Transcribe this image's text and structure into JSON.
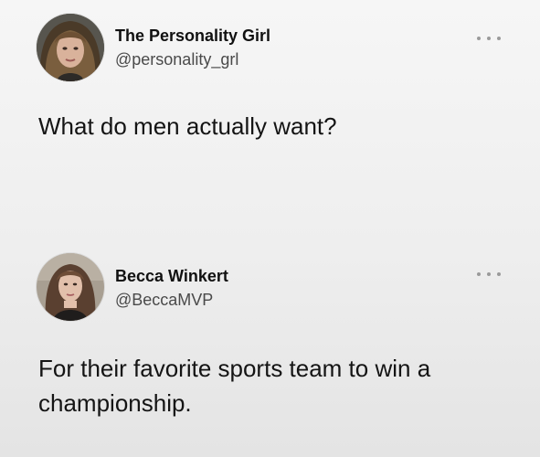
{
  "tweets": [
    {
      "display_name": "The Personality Girl",
      "handle": "@personality_grl",
      "text": "What do men actually want?",
      "more_icon": "more-horizontal-icon"
    },
    {
      "display_name": "Becca Winkert",
      "handle": "@BeccaMVP",
      "text": "For their favorite sports team to win a championship.",
      "more_icon": "more-horizontal-icon"
    }
  ],
  "colors": {
    "background": "#f0f0f0",
    "text": "#141414",
    "handle": "#4a4a4a",
    "more_dots": "#9a9a9a"
  }
}
